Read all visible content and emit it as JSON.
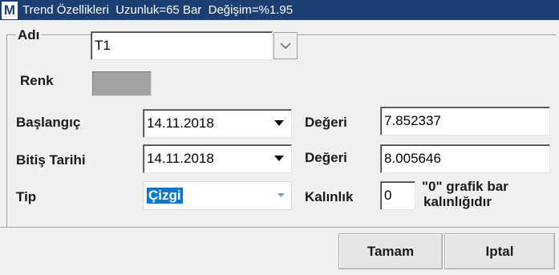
{
  "window": {
    "icon_letter": "M",
    "title": "Trend Özellikleri  Uzunluk=65 Bar  Değişim=%1.95"
  },
  "form": {
    "name_label": "Adı",
    "name_value": "T1",
    "color_label": "Renk",
    "color_value": "#a3a3a3",
    "start_label": "Başlangıç",
    "start_date": "14.11.2018",
    "start_value_label": "Değeri",
    "start_value": "7.852337",
    "end_label": "Bitiş Tarihi",
    "end_date": "14.11.2018",
    "end_value_label": "Değeri",
    "end_value": "8.005646",
    "type_label": "Tip",
    "type_value": "Çizgi",
    "thickness_label": "Kalınlık",
    "thickness_value": "0",
    "thickness_hint_line1": "\"0\" grafik bar",
    "thickness_hint_line2": "kalınlığıdır"
  },
  "buttons": {
    "ok": "Tamam",
    "cancel": "Iptal"
  },
  "icons": {
    "app": "app-logo-icon",
    "name_dropdown": "chevron-down-icon",
    "date_dropdown": "triangle-down-icon",
    "type_dropdown": "small-triangle-down-icon"
  },
  "colors": {
    "titlebar": "#1b3f73",
    "selection": "#0078d7",
    "background": "#f0f0f0"
  }
}
